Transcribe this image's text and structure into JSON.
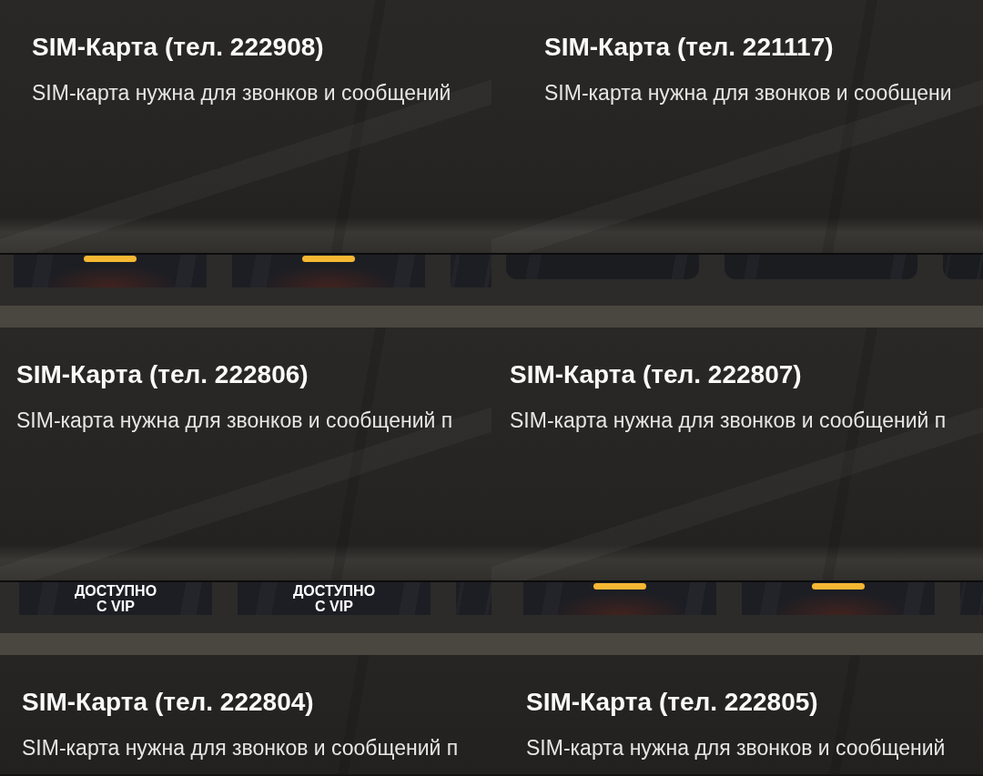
{
  "panels": [
    {
      "title": "SIM-Карта (тел. 222908)",
      "description": "SIM-карта нужна для звонков и сообщений",
      "slots": [
        {
          "kind": "flat",
          "highlighted": true
        },
        {
          "kind": "flat",
          "highlighted": true
        },
        {
          "kind": "flat",
          "highlighted": false
        }
      ]
    },
    {
      "title": "SIM-Карта (тел. 221117)",
      "description": "SIM-карта нужна для звонков и сообщени",
      "slots": [
        {
          "kind": "rounded",
          "highlighted": false
        },
        {
          "kind": "rounded",
          "highlighted": false
        },
        {
          "kind": "rounded",
          "highlighted": false
        }
      ]
    },
    {
      "title": "SIM-Карта (тел. 222806)",
      "description": "SIM-карта нужна для звонков и сообщений п",
      "slots": [
        {
          "kind": "flat",
          "highlighted": false,
          "label": "ДОСТУПНО С VIP"
        },
        {
          "kind": "flat",
          "highlighted": false,
          "label": "ДОСТУПНО С VIP"
        },
        {
          "kind": "flat",
          "highlighted": false
        }
      ]
    },
    {
      "title": "SIM-Карта (тел. 222807)",
      "description": "SIM-карта нужна для звонков и сообщений п",
      "slots": [
        {
          "kind": "flat",
          "highlighted": true
        },
        {
          "kind": "flat",
          "highlighted": true
        },
        {
          "kind": "flat",
          "highlighted": false
        }
      ]
    },
    {
      "title": "SIM-Карта (тел. 222804)",
      "description": "SIM-карта нужна для звонков и сообщений п"
    },
    {
      "title": "SIM-Карта (тел. 222805)",
      "description": "SIM-карта нужна для звонков и сообщений"
    }
  ]
}
